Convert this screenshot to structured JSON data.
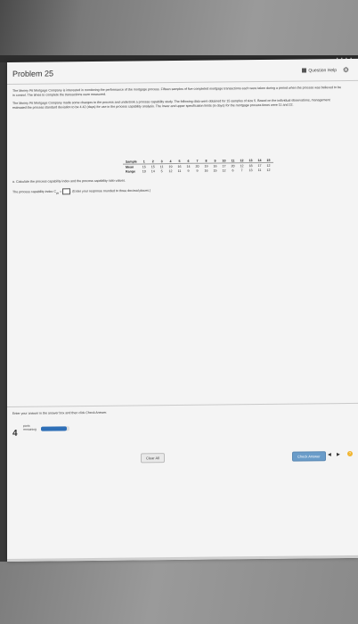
{
  "header": {
    "title": "Problem 25",
    "help_label": "Question Help"
  },
  "paragraphs": {
    "p1": "The Money Pit Mortgage Company is interested in monitoring the performance of the mortgage process. Fifteen samples of five completed mortgage transactions each were taken during a period when the process was believed to be in control. The times to complete the transactions were measured.",
    "p2": "The Money Pit Mortgage Company made some changes to the process and undertook a process capability study. The following data were obtained for 15 samples of size 5. Based on the individual observations, management estimated the process standard deviation to be 4.42 (days) for use in the process capability analysis. The lower and upper specification limits (in days) for the mortgage process times were 11 and 22.",
    "part_a": "a. Calculate the process capability index and the process capability ratio values.",
    "cpk_prefix": "The process capability index C",
    "cpk_sub": "pk",
    "cpk_suffix": "(Enter your response rounded to three decimal places.)"
  },
  "table": {
    "row_label_header": "Sample",
    "samples": [
      "1",
      "2",
      "3",
      "4",
      "5",
      "6",
      "7",
      "8",
      "9",
      "10",
      "11",
      "12",
      "13",
      "14",
      "15"
    ],
    "mean_label": "Mean",
    "means": [
      "15",
      "15",
      "11",
      "19",
      "16",
      "14",
      "20",
      "19",
      "16",
      "17",
      "20",
      "12",
      "18",
      "17",
      "12"
    ],
    "range_label": "Range",
    "ranges": [
      "10",
      "14",
      "5",
      "12",
      "11",
      "9",
      "9",
      "16",
      "15",
      "12",
      "6",
      "7",
      "13",
      "11",
      "12"
    ]
  },
  "footer": {
    "instruction": "Enter your answer in the answer box and then click Check Answer.",
    "parts_count": "4",
    "parts_label": "parts remaining",
    "progress_fraction": 0.9,
    "clear_all": "Clear All",
    "check_answer": "Check Answer"
  },
  "colors": {
    "accent": "#2e6fb7",
    "help_dot": "#f1b530"
  }
}
